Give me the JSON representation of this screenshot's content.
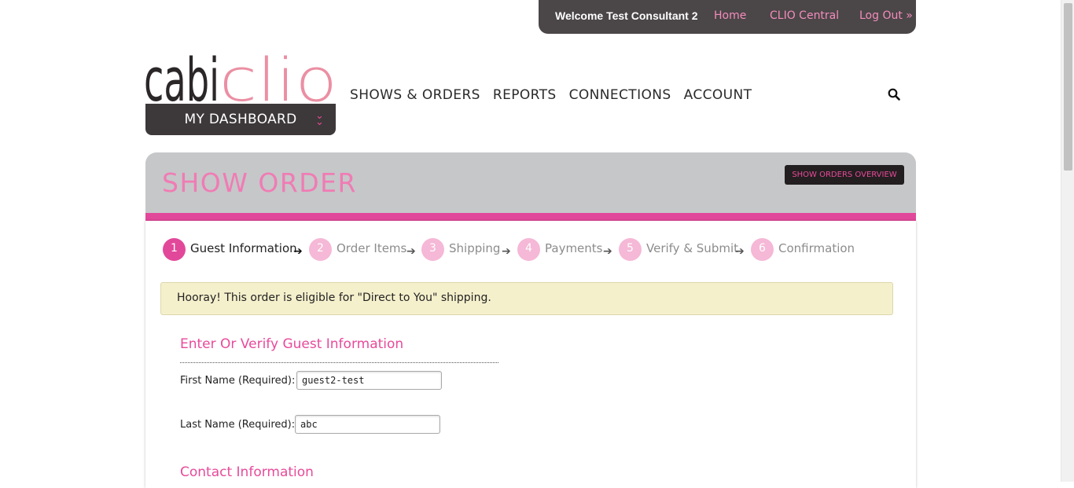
{
  "topbar": {
    "welcome": "Welcome Test Consultant 2",
    "links": [
      "Home",
      "CLIO Central",
      "Log Out »"
    ]
  },
  "logo": {
    "part1": "cabi",
    "part2": "clio"
  },
  "dashboard": {
    "label": "MY DASHBOARD",
    "icon": "double-chevron-down-icon"
  },
  "nav": {
    "items": [
      "SHOWS & ORDERS",
      "REPORTS",
      "CONNECTIONS",
      "ACCOUNT"
    ],
    "search_icon": "search-icon"
  },
  "page": {
    "title": "SHOW ORDER",
    "overview_button": "SHOW ORDERS OVERVIEW"
  },
  "steps": [
    {
      "num": "1",
      "label": "Guest Information",
      "active": true
    },
    {
      "num": "2",
      "label": "Order Items",
      "active": false
    },
    {
      "num": "3",
      "label": "Shipping",
      "active": false
    },
    {
      "num": "4",
      "label": "Payments",
      "active": false
    },
    {
      "num": "5",
      "label": "Verify & Submit",
      "active": false
    },
    {
      "num": "6",
      "label": "Confirmation",
      "active": false
    }
  ],
  "alert": {
    "message": "Hooray! This order is eligible for \"Direct to You\" shipping."
  },
  "form": {
    "section_guest": "Enter Or Verify Guest Information",
    "first_name_label": "First Name (Required):",
    "first_name_value": "guest2-test",
    "last_name_label": "Last Name (Required):",
    "last_name_value": "abc",
    "section_contact": "Contact Information"
  },
  "colors": {
    "pink": "#e84a9a",
    "light_pink": "#f5b8d6",
    "dark": "#3d3839",
    "gray_panel": "#c6c7c9",
    "alert_bg": "#f5f0cc"
  }
}
